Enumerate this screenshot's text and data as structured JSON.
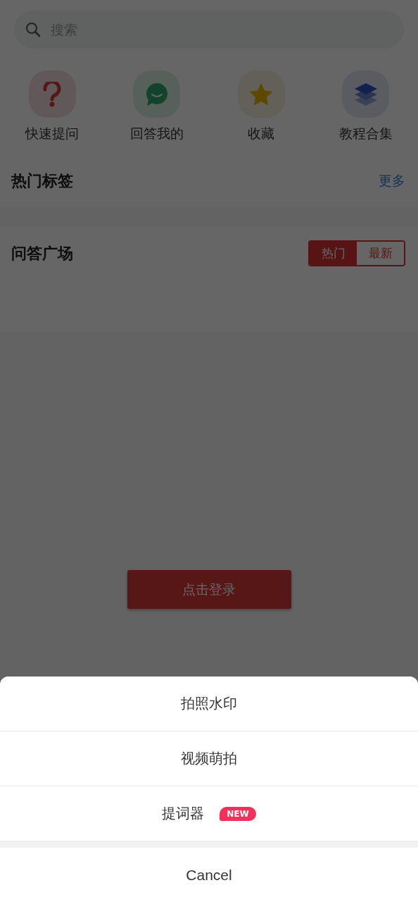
{
  "search": {
    "placeholder": "搜索"
  },
  "shortcuts": [
    {
      "label": "快速提问",
      "kind": "question"
    },
    {
      "label": "回答我的",
      "kind": "chat"
    },
    {
      "label": "收藏",
      "kind": "star"
    },
    {
      "label": "教程合集",
      "kind": "layers"
    }
  ],
  "hot_tags": {
    "title": "热门标签",
    "more": "更多"
  },
  "qa_square": {
    "title": "问答广场",
    "tabs": [
      {
        "label": "热门",
        "selected": true
      },
      {
        "label": "最新",
        "selected": false
      }
    ]
  },
  "login_button": "点击登录",
  "action_sheet": {
    "items": [
      {
        "label": "拍照水印"
      },
      {
        "label": "视频萌拍"
      },
      {
        "label": "提词器",
        "badge": "NEW"
      }
    ],
    "cancel": "Cancel"
  }
}
